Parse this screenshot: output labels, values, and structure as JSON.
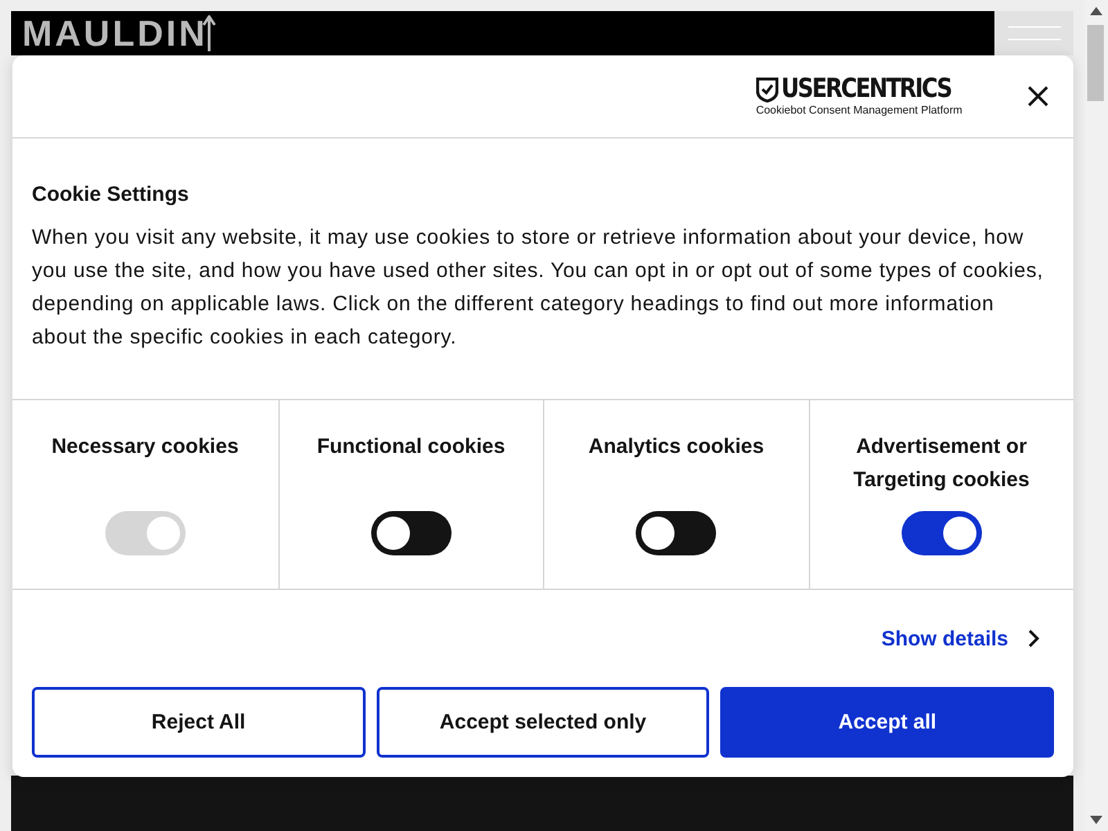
{
  "site": {
    "logo": "MAULDIN"
  },
  "dialog": {
    "brand": "USERCENTRICS",
    "brand_tagline": "Cookiebot Consent Management Platform",
    "title": "Cookie Settings",
    "text": "When you visit any website, it may use cookies to store or retrieve information about your device, how you use the site, and how you have used other sites. You can opt in or opt out of some types of cookies, depending on applicable laws. Click on the different category headings to find out more information about the specific cookies in each category.",
    "categories": [
      {
        "label": "Necessary cookies",
        "checked": true,
        "disabled": true
      },
      {
        "label": "Functional cookies",
        "checked": false,
        "disabled": false
      },
      {
        "label": "Analytics cookies",
        "checked": false,
        "disabled": false
      },
      {
        "label": "Advertisement or Targeting cookies",
        "checked": true,
        "disabled": false
      }
    ],
    "details_link": "Show details",
    "buttons": [
      {
        "label": "Reject All",
        "kind": "outline"
      },
      {
        "label": "Accept selected only",
        "kind": "outline"
      },
      {
        "label": "Accept all",
        "kind": "primary"
      }
    ]
  }
}
